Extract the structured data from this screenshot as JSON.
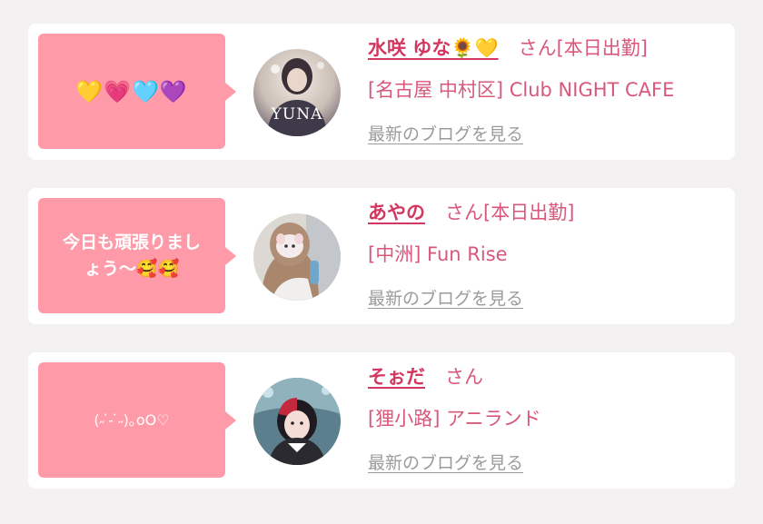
{
  "colors": {
    "accent": "#d2385f",
    "bubble": "#ff9aa8",
    "blog_link": "#9b9b9b",
    "background": "#f3f1f1"
  },
  "blog_link_label": "最新のブログを見る",
  "cards": [
    {
      "message": "💛💗🩵💜",
      "name": "水咲 ゆな🌻💛",
      "honorific": "さん",
      "status": "[本日出勤]",
      "shop": "[名古屋 中村区] Club NIGHT CAFE",
      "avatar_caption": "YUNA"
    },
    {
      "message": "今日も頑張りまし\nょう〜🥰🥰",
      "name": "あやの",
      "honorific": "さん",
      "status": "[本日出勤]",
      "shop": "[中洲] Fun Rise"
    },
    {
      "message": "(˶ ̇ ̵ ̇˶)｡oO♡",
      "name": "そぉだ",
      "honorific": "さん",
      "status": "",
      "shop": "[狸小路] アニランド"
    }
  ]
}
